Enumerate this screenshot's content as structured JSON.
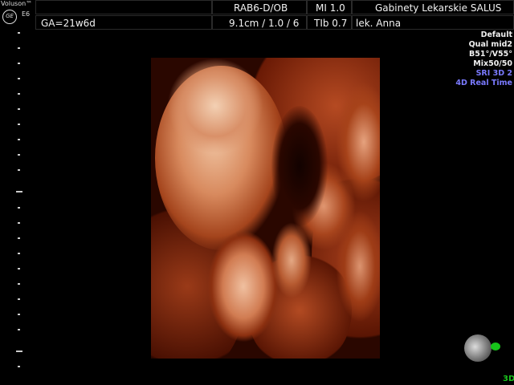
{
  "device": {
    "brand": "Voluson™",
    "logo": "GE",
    "model": "E6"
  },
  "header": {
    "row1": {
      "probe_preset": "RAB6-D/OB",
      "mi": "MI  1.0",
      "clinic": "Gabinety Lekarskie SALUS"
    },
    "row2": {
      "ga": "GA=21w6d",
      "depth_freq": "9.1cm / 1.0 / 6",
      "tib": "TIb  0.7",
      "doctor": "lek. Anna"
    }
  },
  "settings": [
    "Default",
    "Qual mid2",
    "B51°/V55°",
    "Mix50/50"
  ],
  "modes": [
    "SRI 3D 2",
    "4D Real Time"
  ],
  "mode_indicator": "3D",
  "colors": {
    "accent_blue": "#7a7aff",
    "indicator_green": "#19c21c",
    "tissue": "#c0502a"
  },
  "icons": {
    "logo": "ge-logo-icon",
    "orientation": "orientation-sphere-icon"
  }
}
